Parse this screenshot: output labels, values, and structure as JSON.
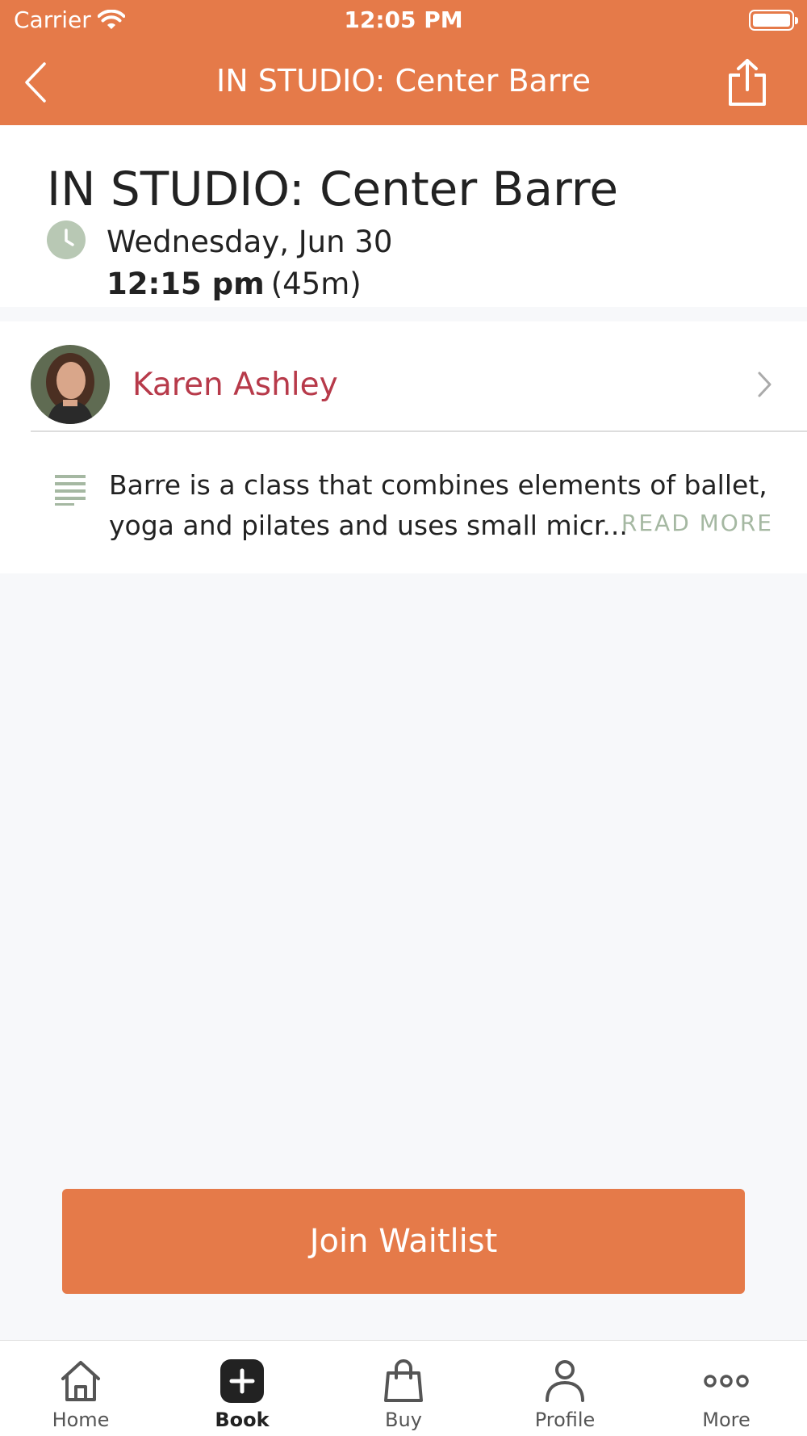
{
  "status_bar": {
    "carrier": "Carrier",
    "time": "12:05 PM"
  },
  "nav": {
    "title": "IN STUDIO: Center Barre"
  },
  "class": {
    "title": "IN STUDIO: Center Barre",
    "date": "Wednesday, Jun 30",
    "time": "12:15 pm",
    "duration": "(45m)"
  },
  "instructor": {
    "name": "Karen Ashley"
  },
  "description": {
    "text": "Barre is a class that combines elements of ballet, yoga and pilates and uses small micr...",
    "read_more": "READ MORE"
  },
  "actions": {
    "join": "Join Waitlist"
  },
  "tabs": [
    {
      "label": "Home",
      "icon": "home-icon"
    },
    {
      "label": "Book",
      "icon": "book-plus-icon"
    },
    {
      "label": "Buy",
      "icon": "shopping-bag-icon"
    },
    {
      "label": "Profile",
      "icon": "person-icon"
    },
    {
      "label": "More",
      "icon": "more-dots-icon"
    }
  ],
  "active_tab": "Book",
  "colors": {
    "brand": "#e57a49",
    "instructor_name": "#b73a4a",
    "accent_green": "#a5b8a2"
  }
}
